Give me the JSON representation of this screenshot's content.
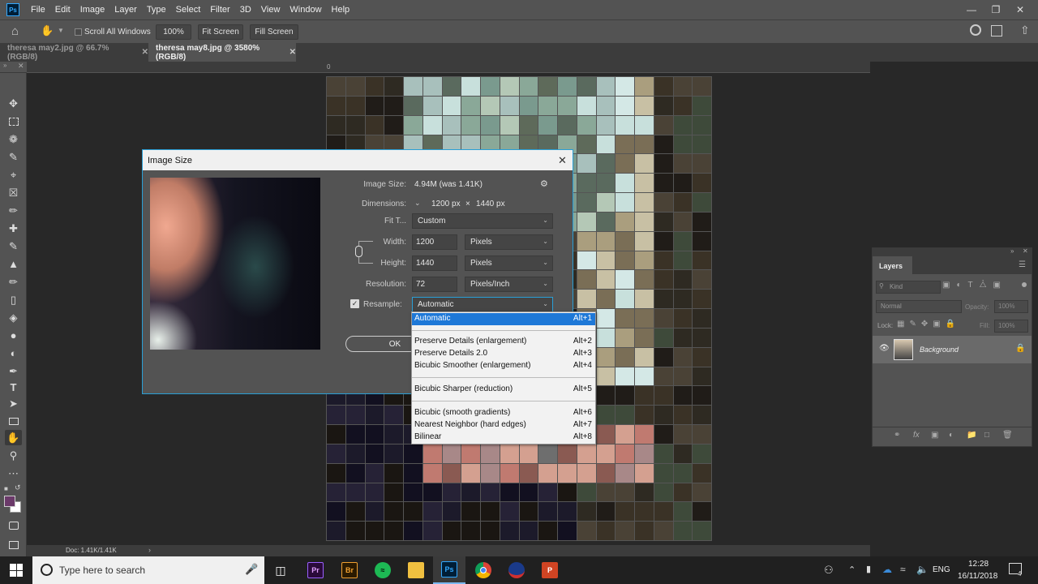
{
  "menubar": {
    "app_logo": "Ps",
    "menus": [
      "File",
      "Edit",
      "Image",
      "Layer",
      "Type",
      "Select",
      "Filter",
      "3D",
      "View",
      "Window",
      "Help"
    ]
  },
  "options_bar": {
    "scroll_all_windows": "Scroll All Windows",
    "zoom_100": "100%",
    "fit_screen": "Fit Screen",
    "fill_screen": "Fill Screen"
  },
  "tabs": [
    {
      "label": "theresa may2.jpg @ 66.7% (RGB/8)",
      "active": false
    },
    {
      "label": "theresa may8.jpg @ 3580% (RGB/8)",
      "active": true
    }
  ],
  "ruler": {
    "origin_label": "0"
  },
  "status": {
    "doc": "Doc: 1.41K/1.41K"
  },
  "dialog": {
    "title": "Image Size",
    "image_size_label": "Image Size:",
    "image_size_value": "4.94M (was 1.41K)",
    "dimensions_label": "Dimensions:",
    "dimensions_width": "1200 px",
    "dimensions_x": "×",
    "dimensions_height": "1440 px",
    "fit_to_label": "Fit T...",
    "fit_to_value": "Custom",
    "width_label": "Width:",
    "width_value": "1200",
    "width_unit": "Pixels",
    "height_label": "Height:",
    "height_value": "1440",
    "height_unit": "Pixels",
    "resolution_label": "Resolution:",
    "resolution_value": "72",
    "resolution_unit": "Pixels/Inch",
    "resample_label": "Resample:",
    "resample_checked": true,
    "resample_value": "Automatic",
    "ok_label": "OK"
  },
  "resample_options": [
    {
      "label": "Automatic",
      "shortcut": "Alt+1",
      "selected": true
    },
    {
      "label": "Preserve Details (enlargement)",
      "shortcut": "Alt+2",
      "selected": false
    },
    {
      "label": "Preserve Details 2.0",
      "shortcut": "Alt+3",
      "selected": false
    },
    {
      "label": "Bicubic Smoother (enlargement)",
      "shortcut": "Alt+4",
      "selected": false
    },
    {
      "label": "Bicubic Sharper (reduction)",
      "shortcut": "Alt+5",
      "selected": false
    },
    {
      "label": "Bicubic (smooth gradients)",
      "shortcut": "Alt+6",
      "selected": false
    },
    {
      "label": "Nearest Neighbor (hard edges)",
      "shortcut": "Alt+7",
      "selected": false
    },
    {
      "label": "Bilinear",
      "shortcut": "Alt+8",
      "selected": false
    }
  ],
  "layers_panel": {
    "title": "Layers",
    "kind_label": "Kind",
    "blend_mode": "Normal",
    "opacity_label": "Opacity:",
    "opacity_value": "100%",
    "lock_label": "Lock:",
    "fill_label": "Fill:",
    "fill_value": "100%",
    "layer_name": "Background"
  },
  "taskbar": {
    "search_placeholder": "Type here to search",
    "language": "ENG",
    "time": "12:28",
    "date": "16/11/2018",
    "notification_count": "4"
  },
  "colors": {
    "accent": "#1e78d7",
    "dialog_border": "#2a9fd6",
    "foreground_swatch": "#6b3a6a"
  }
}
